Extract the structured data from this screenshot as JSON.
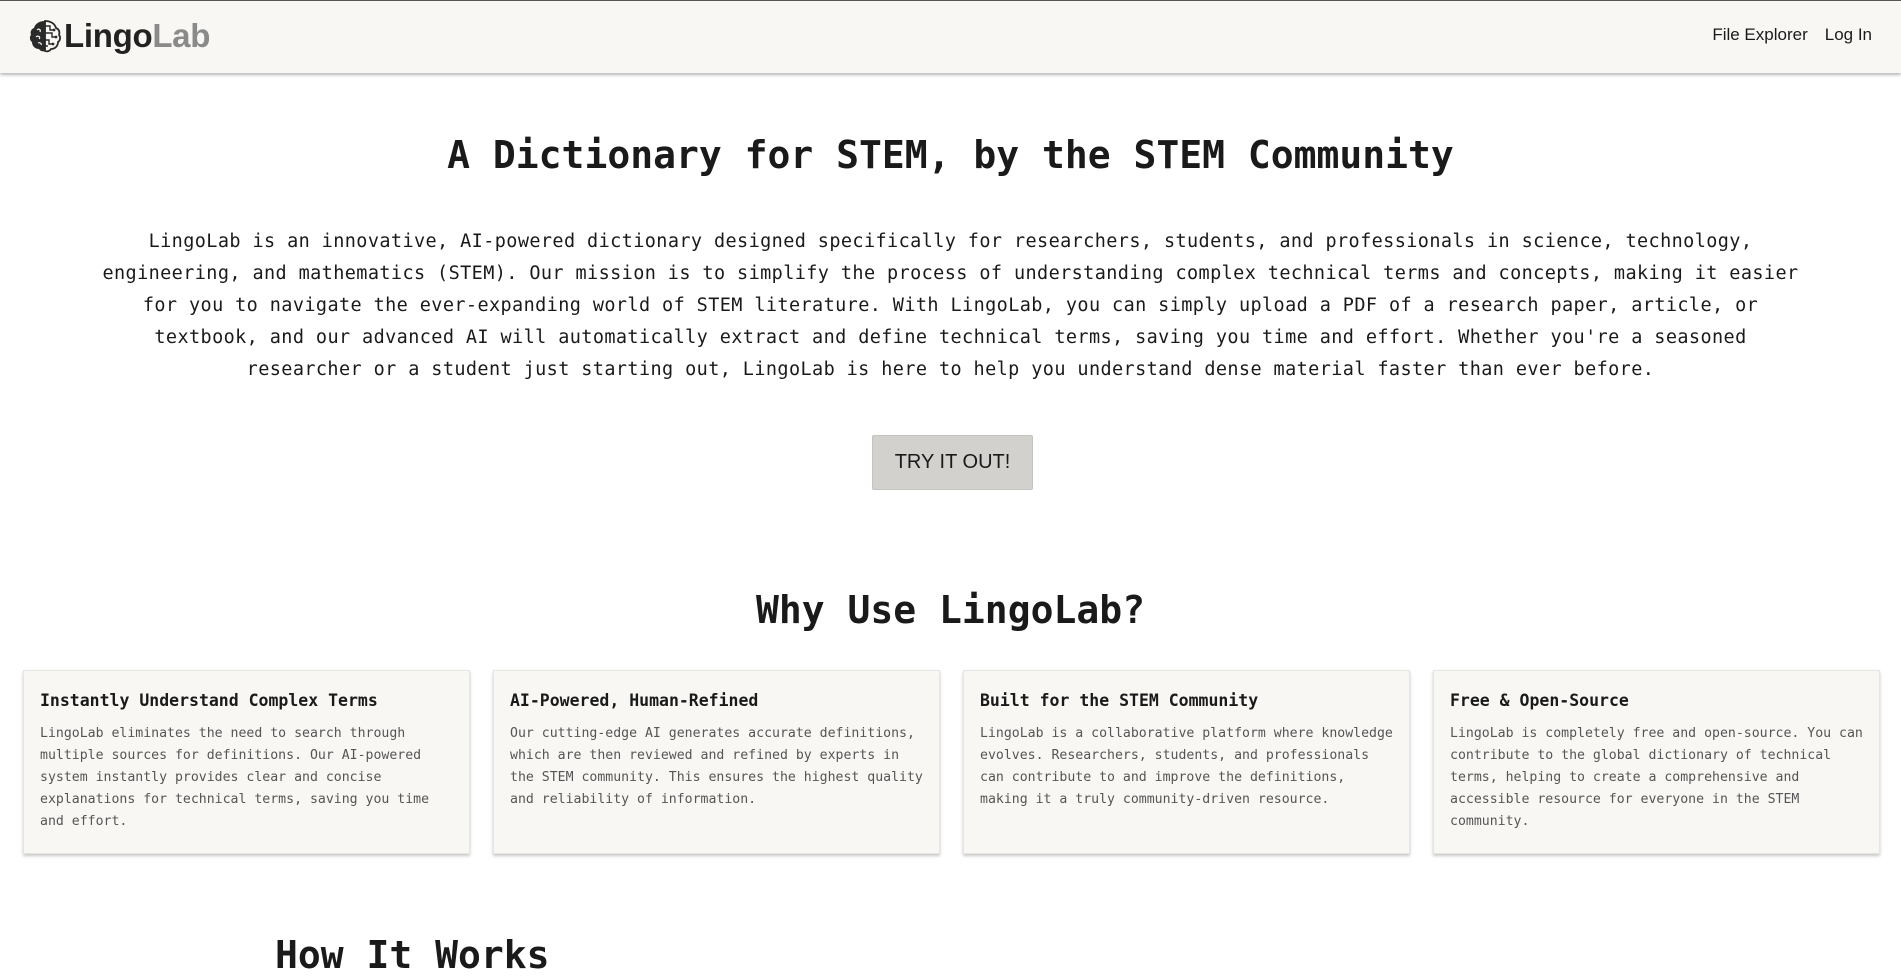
{
  "navbar": {
    "brand_part1": "Lingo",
    "brand_part2": "Lab",
    "logo_icon": "brain-icon",
    "links": [
      "File Explorer",
      "Log In"
    ]
  },
  "hero": {
    "title": "A Dictionary for STEM, by the STEM Community",
    "description": "LingoLab is an innovative, AI-powered dictionary designed specifically for researchers, students, and professionals in science, technology, engineering, and mathematics (STEM). Our mission is to simplify the process of understanding complex technical terms and concepts, making it easier for you to navigate the ever-expanding world of STEM literature. With LingoLab, you can simply upload a PDF of a research paper, article, or textbook, and our advanced AI will automatically extract and define technical terms, saving you time and effort. Whether you're a seasoned researcher or a student just starting out, LingoLab is here to help you understand dense material faster than ever before.",
    "cta_label": "TRY IT OUT!"
  },
  "why": {
    "title": "Why Use LingoLab?",
    "cards": [
      {
        "title": "Instantly Understand Complex Terms",
        "body": "LingoLab eliminates the need to search through multiple sources for definitions. Our AI-powered system instantly provides clear and concise explanations for technical terms, saving you time and effort."
      },
      {
        "title": "AI-Powered, Human-Refined",
        "body": "Our cutting-edge AI generates accurate definitions, which are then reviewed and refined by experts in the STEM community. This ensures the highest quality and reliability of information."
      },
      {
        "title": "Built for the STEM Community",
        "body": "LingoLab is a collaborative platform where knowledge evolves. Researchers, students, and professionals can contribute to and improve the definitions, making it a truly community-driven resource."
      },
      {
        "title": "Free & Open-Source",
        "body": "LingoLab is completely free and open-source. You can contribute to the global dictionary of technical terms, helping to create a comprehensive and accessible resource for everyone in the STEM community."
      }
    ]
  },
  "next_section": {
    "partial_title": "How It Works"
  },
  "colors": {
    "navbar_bg": "#f8f7f4",
    "card_bg": "#f8f7f4",
    "cta_bg": "#d2d1cd",
    "brand_secondary": "#8a8a8a"
  }
}
